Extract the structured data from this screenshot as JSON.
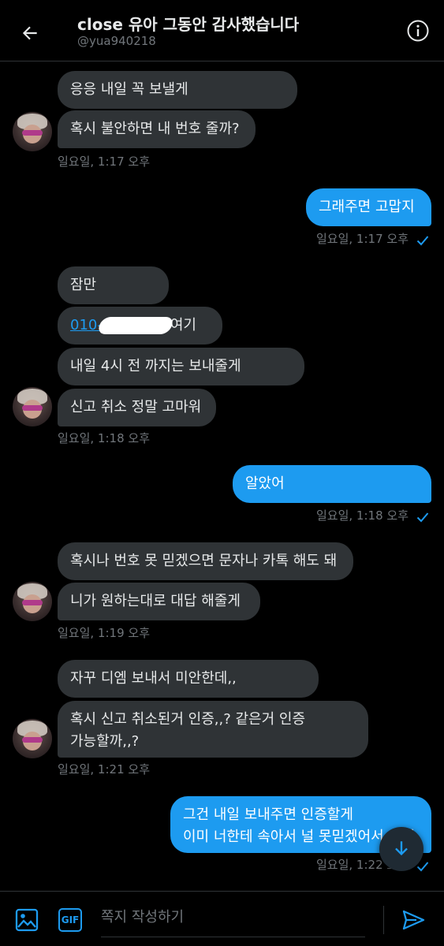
{
  "header": {
    "title": "close 유아 그동안 감사했습니다",
    "handle": "@yua940218"
  },
  "messages": {
    "m1": "응응 내일 꼭 보낼게",
    "m2": "혹시 불안하면 내 번호 줄까?",
    "ts1": "일요일, 1:17 오후",
    "m3": "그래주면 고맙지",
    "ts2": "일요일, 1:17 오후",
    "m4": "잠만",
    "m5_link": "010-",
    "m5_suffix": "여기",
    "m6": "내일 4시 전 까지는 보내줄게",
    "m7": "신고 취소 정말 고마워",
    "ts3": "일요일, 1:18 오후",
    "m8": "알았어",
    "ts4": "일요일, 1:18 오후",
    "m9": "혹시나 번호 못 믿겠으면 문자나 카톡 해도 돼",
    "m10": "니가 원하는대로 대답 해줄게",
    "ts5": "일요일, 1:19 오후",
    "m11": "자꾸 디엠 보내서 미안한데,,",
    "m12_line1": "혹시 신고 취소된거 인증,,? 같은거 인증",
    "m12_line2": "가능할까,,?",
    "ts6": "일요일, 1:21 오후",
    "m13_line1": "그건 내일 보내주면 인증할게",
    "m13_line2": "이미 너한테 속아서 널 못믿겠어서 그래",
    "ts7": "일요일, 1:22 오후"
  },
  "composer": {
    "placeholder": "쪽지 작성하기",
    "gif_label": "GIF"
  },
  "colors": {
    "accent": "#1d9bf0",
    "incoming_bubble": "#2f3336",
    "background": "#000000",
    "muted_text": "#71767b"
  }
}
